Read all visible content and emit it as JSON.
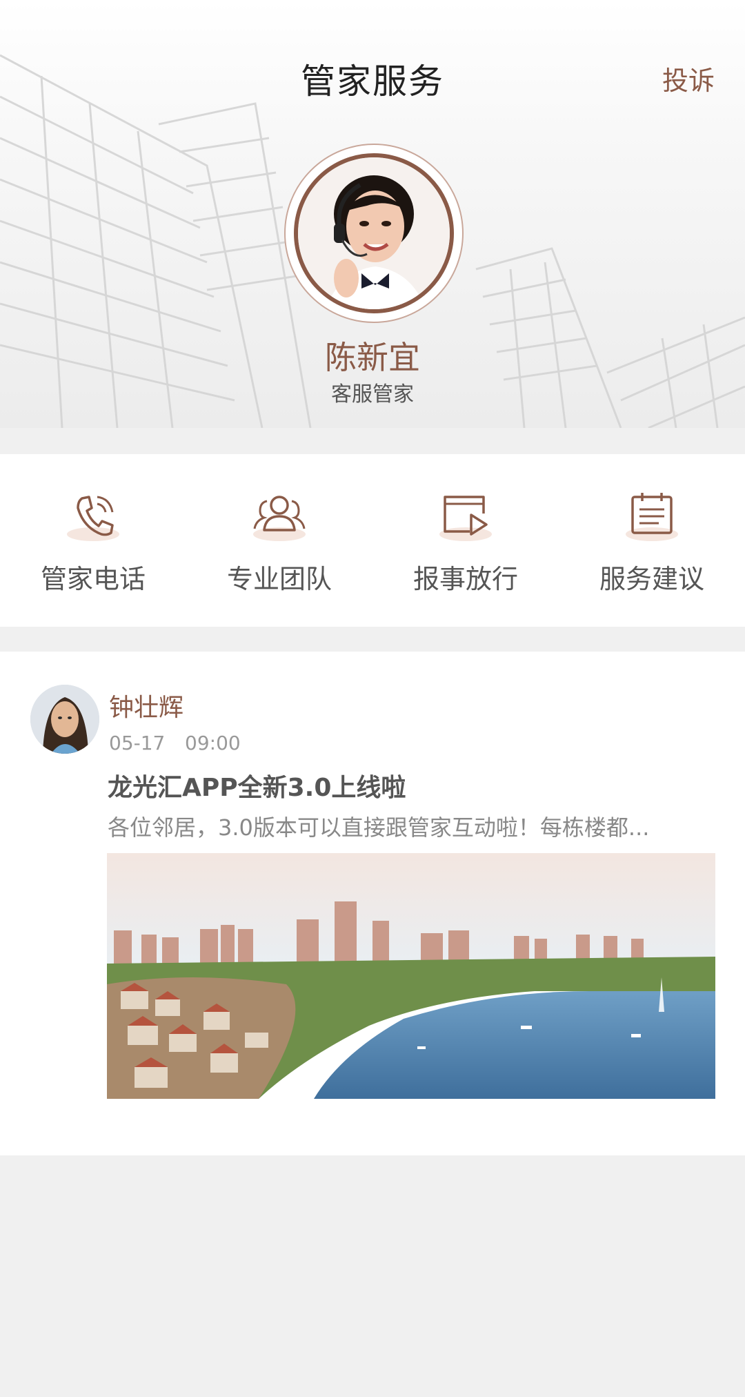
{
  "header": {
    "title": "管家服务",
    "complain_label": "投诉"
  },
  "manager": {
    "name": "陈新宜",
    "role": "客服管家"
  },
  "services": [
    {
      "label": "管家电话",
      "icon": "phone-icon"
    },
    {
      "label": "专业团队",
      "icon": "team-icon"
    },
    {
      "label": "报事放行",
      "icon": "video-release-icon"
    },
    {
      "label": "服务建议",
      "icon": "clipboard-icon"
    }
  ],
  "post": {
    "author": "钟壮辉",
    "date": "05-17",
    "time": "09:00",
    "title": "龙光汇APP全新3.0上线啦",
    "excerpt": "各位邻居，3.0版本可以直接跟管家互动啦！每栋楼都..."
  },
  "colors": {
    "accent": "#8a5a47",
    "icon_bg": "#f5e6df",
    "page_bg": "#f0f0f0"
  }
}
